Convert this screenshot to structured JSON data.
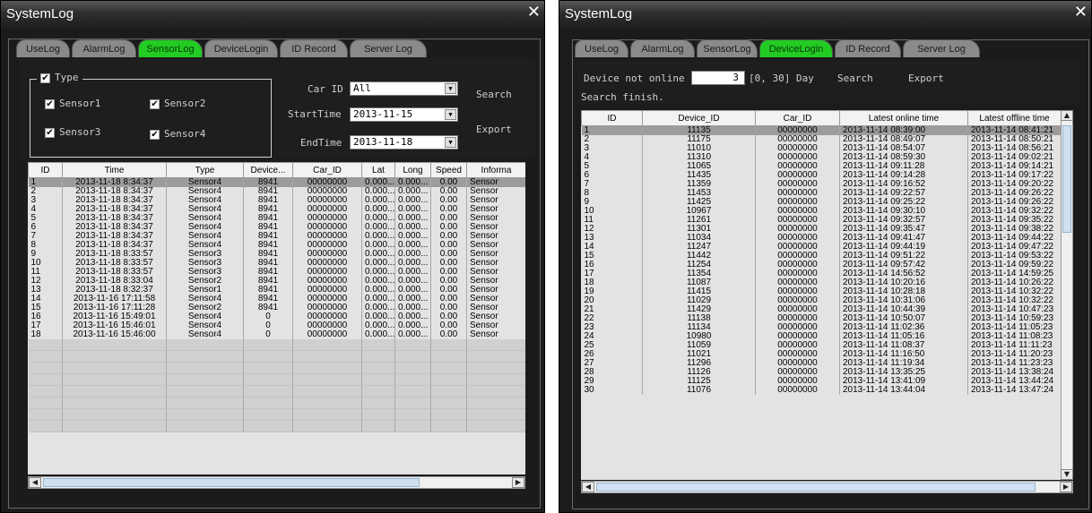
{
  "left_window": {
    "title": "SystemLog",
    "tabs": [
      {
        "label": "UseLog",
        "active": false
      },
      {
        "label": "AlarmLog",
        "active": false
      },
      {
        "label": "SensorLog",
        "active": true
      },
      {
        "label": "DeviceLogin",
        "active": false
      },
      {
        "label": "ID Record",
        "active": false
      },
      {
        "label": "Server Log",
        "active": false
      }
    ],
    "type_group": {
      "label": "Type",
      "checked": true,
      "sensors": [
        {
          "label": "Sensor1",
          "checked": true
        },
        {
          "label": "Sensor2",
          "checked": true
        },
        {
          "label": "Sensor3",
          "checked": true
        },
        {
          "label": "Sensor4",
          "checked": true
        }
      ]
    },
    "filters": {
      "car_id_label": "Car ID",
      "car_id_value": "All",
      "start_label": "StartTime",
      "start_value": "2013-11-15",
      "end_label": "EndTime",
      "end_value": "2013-11-18"
    },
    "search_label": "Search",
    "export_label": "Export",
    "columns": [
      "ID",
      "Time",
      "Type",
      "Device...",
      "Car_ID",
      "Lat",
      "Long",
      "Speed",
      "Informa"
    ],
    "rows": [
      [
        "1",
        "2013-11-18 8:34:37",
        "Sensor4",
        "8941",
        "00000000",
        "0.000...",
        "0.000...",
        "0.00",
        "Sensor"
      ],
      [
        "2",
        "2013-11-18 8:34:37",
        "Sensor4",
        "8941",
        "00000000",
        "0.000...",
        "0.000...",
        "0.00",
        "Sensor"
      ],
      [
        "3",
        "2013-11-18 8:34:37",
        "Sensor4",
        "8941",
        "00000000",
        "0.000...",
        "0.000...",
        "0.00",
        "Sensor"
      ],
      [
        "4",
        "2013-11-18 8:34:37",
        "Sensor4",
        "8941",
        "00000000",
        "0.000...",
        "0.000...",
        "0.00",
        "Sensor"
      ],
      [
        "5",
        "2013-11-18 8:34:37",
        "Sensor4",
        "8941",
        "00000000",
        "0.000...",
        "0.000...",
        "0.00",
        "Sensor"
      ],
      [
        "6",
        "2013-11-18 8:34:37",
        "Sensor4",
        "8941",
        "00000000",
        "0.000...",
        "0.000...",
        "0.00",
        "Sensor"
      ],
      [
        "7",
        "2013-11-18 8:34:37",
        "Sensor4",
        "8941",
        "00000000",
        "0.000...",
        "0.000...",
        "0.00",
        "Sensor"
      ],
      [
        "8",
        "2013-11-18 8:34:37",
        "Sensor4",
        "8941",
        "00000000",
        "0.000...",
        "0.000...",
        "0.00",
        "Sensor"
      ],
      [
        "9",
        "2013-11-18 8:33:57",
        "Sensor3",
        "8941",
        "00000000",
        "0.000...",
        "0.000...",
        "0.00",
        "Sensor"
      ],
      [
        "10",
        "2013-11-18 8:33:57",
        "Sensor3",
        "8941",
        "00000000",
        "0.000...",
        "0.000...",
        "0.00",
        "Sensor"
      ],
      [
        "11",
        "2013-11-18 8:33:57",
        "Sensor3",
        "8941",
        "00000000",
        "0.000...",
        "0.000...",
        "0.00",
        "Sensor"
      ],
      [
        "12",
        "2013-11-18 8:33:04",
        "Sensor2",
        "8941",
        "00000000",
        "0.000...",
        "0.000...",
        "0.00",
        "Sensor"
      ],
      [
        "13",
        "2013-11-18 8:32:37",
        "Sensor1",
        "8941",
        "00000000",
        "0.000...",
        "0.000...",
        "0.00",
        "Sensor"
      ],
      [
        "14",
        "2013-11-16 17:11:58",
        "Sensor4",
        "8941",
        "00000000",
        "0.000...",
        "0.000...",
        "0.00",
        "Sensor"
      ],
      [
        "15",
        "2013-11-16 17:11:28",
        "Sensor2",
        "8941",
        "00000000",
        "0.000...",
        "0.000...",
        "0.00",
        "Sensor"
      ],
      [
        "16",
        "2013-11-16 15:49:01",
        "Sensor4",
        "0",
        "00000000",
        "0.000...",
        "0.000...",
        "0.00",
        "Sensor"
      ],
      [
        "17",
        "2013-11-16 15:46:01",
        "Sensor4",
        "0",
        "00000000",
        "0.000...",
        "0.000...",
        "0.00",
        "Sensor"
      ],
      [
        "18",
        "2013-11-16 15:46:00",
        "Sensor4",
        "0",
        "00000000",
        "0.000...",
        "0.000...",
        "0.00",
        "Sensor"
      ]
    ]
  },
  "right_window": {
    "title": "SystemLog",
    "tabs": [
      {
        "label": "UseLog",
        "active": false
      },
      {
        "label": "AlarmLog",
        "active": false
      },
      {
        "label": "SensorLog",
        "active": false
      },
      {
        "label": "DeviceLogin",
        "active": true
      },
      {
        "label": "ID Record",
        "active": false
      },
      {
        "label": "Server Log",
        "active": false
      }
    ],
    "device_not_online_label": "Device not online",
    "days_value": "3",
    "range_label": "[0, 30] Day",
    "search_label": "Search",
    "export_label": "Export",
    "status_text": "Search finish.",
    "columns": [
      "ID",
      "Device_ID",
      "Car_ID",
      "Latest online time",
      "Latest offline time"
    ],
    "rows": [
      [
        "1",
        "11135",
        "00000000",
        "2013-11-14 08:39:00",
        "2013-11-14 08:41:21"
      ],
      [
        "2",
        "11175",
        "00000000",
        "2013-11-14 08:49:07",
        "2013-11-14 08:50:21"
      ],
      [
        "3",
        "11010",
        "00000000",
        "2013-11-14 08:54:07",
        "2013-11-14 08:56:21"
      ],
      [
        "4",
        "11310",
        "00000000",
        "2013-11-14 08:59:30",
        "2013-11-14 09:02:21"
      ],
      [
        "5",
        "11065",
        "00000000",
        "2013-11-14 09:11:28",
        "2013-11-14 09:14:21"
      ],
      [
        "6",
        "11435",
        "00000000",
        "2013-11-14 09:14:28",
        "2013-11-14 09:17:22"
      ],
      [
        "7",
        "11359",
        "00000000",
        "2013-11-14 09:16:52",
        "2013-11-14 09:20:22"
      ],
      [
        "8",
        "11453",
        "00000000",
        "2013-11-14 09:22:57",
        "2013-11-14 09:26:22"
      ],
      [
        "9",
        "11425",
        "00000000",
        "2013-11-14 09:25:22",
        "2013-11-14 09:26:22"
      ],
      [
        "10",
        "10967",
        "00000000",
        "2013-11-14 09:30:10",
        "2013-11-14 09:32:22"
      ],
      [
        "11",
        "11261",
        "00000000",
        "2013-11-14 09:32:57",
        "2013-11-14 09:35:22"
      ],
      [
        "12",
        "11301",
        "00000000",
        "2013-11-14 09:35:47",
        "2013-11-14 09:38:22"
      ],
      [
        "13",
        "11034",
        "00000000",
        "2013-11-14 09:41:47",
        "2013-11-14 09:44:22"
      ],
      [
        "14",
        "11247",
        "00000000",
        "2013-11-14 09:44:19",
        "2013-11-14 09:47:22"
      ],
      [
        "15",
        "11442",
        "00000000",
        "2013-11-14 09:51:22",
        "2013-11-14 09:53:22"
      ],
      [
        "16",
        "11254",
        "00000000",
        "2013-11-14 09:57:42",
        "2013-11-14 09:59:22"
      ],
      [
        "17",
        "11354",
        "00000000",
        "2013-11-14 14:56:52",
        "2013-11-14 14:59:25"
      ],
      [
        "18",
        "11087",
        "00000000",
        "2013-11-14 10:20:16",
        "2013-11-14 10:26:22"
      ],
      [
        "19",
        "11415",
        "00000000",
        "2013-11-14 10:28:18",
        "2013-11-14 10:32:22"
      ],
      [
        "20",
        "11029",
        "00000000",
        "2013-11-14 10:31:06",
        "2013-11-14 10:32:22"
      ],
      [
        "21",
        "11429",
        "00000000",
        "2013-11-14 10:44:39",
        "2013-11-14 10:47:23"
      ],
      [
        "22",
        "11138",
        "00000000",
        "2013-11-14 10:50:07",
        "2013-11-14 10:59:23"
      ],
      [
        "23",
        "11134",
        "00000000",
        "2013-11-14 11:02:36",
        "2013-11-14 11:05:23"
      ],
      [
        "24",
        "10980",
        "00000000",
        "2013-11-14 11:05:16",
        "2013-11-14 11:08:23"
      ],
      [
        "25",
        "11059",
        "00000000",
        "2013-11-14 11:08:37",
        "2013-11-14 11:11:23"
      ],
      [
        "26",
        "11021",
        "00000000",
        "2013-11-14 11:16:50",
        "2013-11-14 11:20:23"
      ],
      [
        "27",
        "11296",
        "00000000",
        "2013-11-14 11:19:34",
        "2013-11-14 11:23:23"
      ],
      [
        "28",
        "11126",
        "00000000",
        "2013-11-14 13:35:25",
        "2013-11-14 13:38:24"
      ],
      [
        "29",
        "11125",
        "00000000",
        "2013-11-14 13:41:09",
        "2013-11-14 13:44:24"
      ],
      [
        "30",
        "11076",
        "00000000",
        "2013-11-14 13:44:04",
        "2013-11-14 13:47:24"
      ]
    ]
  }
}
